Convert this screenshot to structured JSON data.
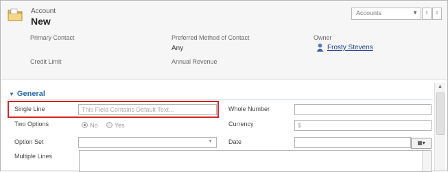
{
  "header": {
    "entity_type": "Account",
    "record_name": "New",
    "form_selector": "Accounts",
    "fields": [
      {
        "label": "Primary Contact",
        "value": ""
      },
      {
        "label": "Preferred Method of Contact",
        "value": "Any"
      },
      {
        "label": "Owner",
        "value": "Frosty Stevens"
      },
      {
        "label": "Credit Limit",
        "value": ""
      },
      {
        "label": "Annual Revenue",
        "value": ""
      }
    ]
  },
  "section": {
    "title": "General",
    "single_line": {
      "label": "Single Line",
      "placeholder": "This Field Contains Default Text..."
    },
    "two_options": {
      "label": "Two Options",
      "option_no": "No",
      "option_yes": "Yes",
      "selected": "No"
    },
    "option_set": {
      "label": "Option Set",
      "value": ""
    },
    "multiple_lines": {
      "label": "Multiple Lines",
      "value": ""
    },
    "whole_number": {
      "label": "Whole Number",
      "value": ""
    },
    "currency": {
      "label": "Currency",
      "value": "$"
    },
    "date": {
      "label": "Date",
      "value": ""
    }
  },
  "colors": {
    "highlight_border": "#d42426",
    "section_title": "#2b6ab0",
    "link": "#1c3b8c"
  },
  "icons": [
    "folder-icon",
    "user-icon",
    "calendar-icon",
    "chevron-down-icon",
    "arrow-up-icon",
    "arrow-down-icon"
  ]
}
